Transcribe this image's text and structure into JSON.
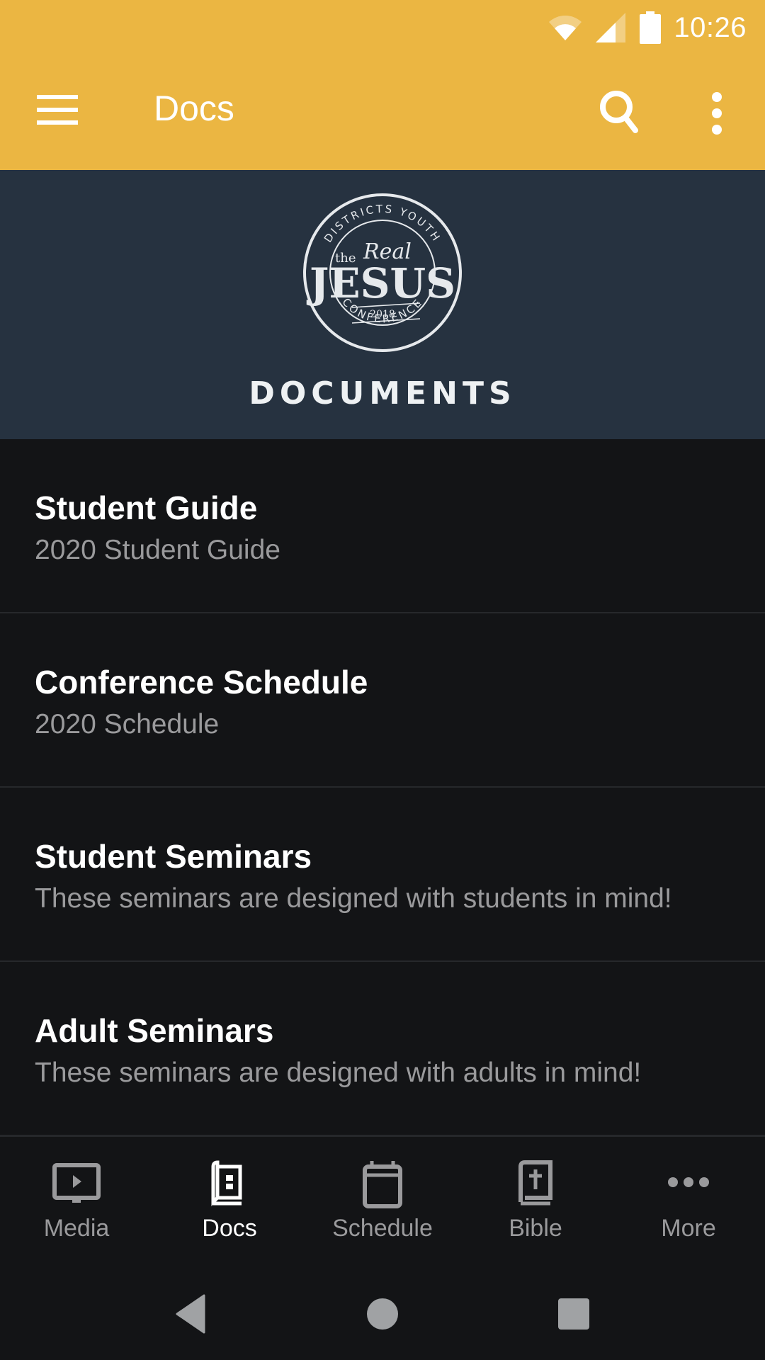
{
  "status_bar": {
    "time": "10:26",
    "icons": [
      "wifi-icon",
      "cell-signal-icon",
      "battery-icon"
    ]
  },
  "app_bar": {
    "title": "Docs",
    "menu_icon": "hamburger-menu-icon",
    "search_icon": "search-icon",
    "overflow_icon": "more-vert-icon",
    "color": "#ebb642"
  },
  "banner": {
    "logo": {
      "top_arc": "DISTRICTS YOUTH",
      "prefix": "the",
      "script": "Real",
      "main": "JESUS",
      "year": "2018",
      "bottom_arc": "CONFERENCE"
    },
    "caption": "DOCUMENTS",
    "color": "#263240"
  },
  "documents": [
    {
      "title": "Student Guide",
      "subtitle": "2020 Student Guide"
    },
    {
      "title": "Conference Schedule",
      "subtitle": "2020 Schedule"
    },
    {
      "title": "Student Seminars",
      "subtitle": "These seminars are designed with students in mind!"
    },
    {
      "title": "Adult Seminars",
      "subtitle": "These seminars are designed with adults in mind!"
    }
  ],
  "bottom_nav": {
    "active": "Docs",
    "items": [
      {
        "label": "Media",
        "icon": "media-tv-icon"
      },
      {
        "label": "Docs",
        "icon": "docs-book-icon"
      },
      {
        "label": "Schedule",
        "icon": "calendar-icon"
      },
      {
        "label": "Bible",
        "icon": "bible-icon"
      },
      {
        "label": "More",
        "icon": "more-horiz-icon"
      }
    ]
  },
  "system_nav": [
    "back",
    "home",
    "recents"
  ]
}
